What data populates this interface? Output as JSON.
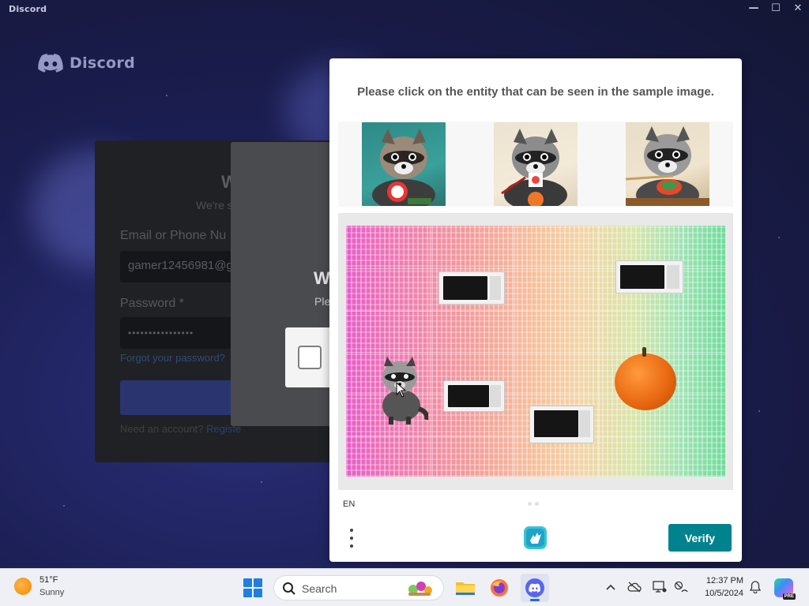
{
  "window": {
    "title": "Discord",
    "controls": {
      "minimize": "—",
      "maximize": "☐",
      "close": "✕"
    }
  },
  "brand": {
    "name": "Discord",
    "icon": "discord-logo-icon"
  },
  "login": {
    "heading": "W",
    "subheading": "We're s",
    "email_label": "Email or Phone Nu",
    "email_value": "gamer12456981@g",
    "password_label": "Password *",
    "password_value": "••••••••••••••••",
    "forgot_link": "Forgot your password?",
    "register_prompt": "Need an account?",
    "register_link": "Registe"
  },
  "verification_modal": {
    "title": "W",
    "subtitle": "Ple"
  },
  "captcha": {
    "prompt": "Please click on the entity that can be seen in the sample image.",
    "samples": [
      {
        "label": "raccoon-with-sushi-1",
        "icon": "raccoon-sample-icon"
      },
      {
        "label": "raccoon-with-sushi-2",
        "icon": "raccoon-sample-icon"
      },
      {
        "label": "raccoon-with-sushi-3",
        "icon": "raccoon-sample-icon"
      }
    ],
    "language": "EN",
    "verify_label": "Verify",
    "accent_color": "#00838f"
  },
  "taskbar": {
    "weather_temp": "51°F",
    "weather_condition": "Sunny",
    "search_placeholder": "Search",
    "time": "12:37 PM",
    "date": "10/5/2024",
    "copilot_badge": "PRE"
  }
}
